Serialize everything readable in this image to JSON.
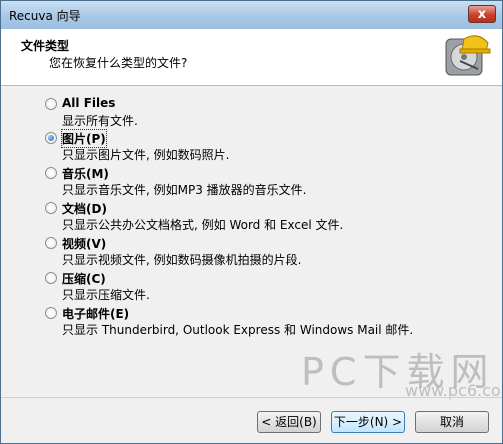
{
  "window": {
    "title": "Recuva 向导",
    "close_label": "x"
  },
  "header": {
    "title": "文件类型",
    "subtitle": "您在恢复什么类型的文件?"
  },
  "options": [
    {
      "label": "All Files",
      "desc": "显示所有文件.",
      "selected": false
    },
    {
      "label": "图片(P)",
      "desc": "只显示图片文件, 例如数码照片.",
      "selected": true
    },
    {
      "label": "音乐(M)",
      "desc": "只显示音乐文件, 例如MP3 播放器的音乐文件.",
      "selected": false
    },
    {
      "label": "文档(D)",
      "desc": "只显示公共办公文档格式, 例如 Word 和 Excel 文件.",
      "selected": false
    },
    {
      "label": "视频(V)",
      "desc": "只显示视频文件, 例如数码摄像机拍摄的片段.",
      "selected": false
    },
    {
      "label": "压缩(C)",
      "desc": "只显示压缩文件.",
      "selected": false
    },
    {
      "label": "电子邮件(E)",
      "desc": "只显示 Thunderbird, Outlook Express 和 Windows Mail 邮件.",
      "selected": false
    }
  ],
  "buttons": {
    "back": "< 返回(B)",
    "next": "下一步(N) >",
    "cancel": "取消"
  },
  "watermark": {
    "main": "PC下载网",
    "sub": "www.pc6.com.cn"
  },
  "colors": {
    "accent": "#1f5fa7",
    "titlebar": "#a9c8e6"
  }
}
